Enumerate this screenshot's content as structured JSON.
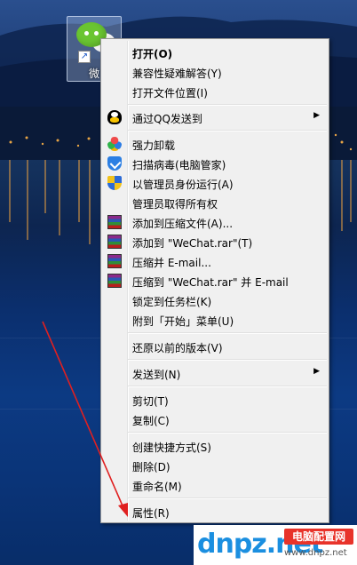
{
  "desktop": {
    "icon": {
      "name": "wechat-icon",
      "label": "微"
    }
  },
  "context_menu": {
    "items": [
      {
        "label": "打开(O)",
        "bold": true
      },
      {
        "label": "兼容性疑难解答(Y)"
      },
      {
        "label": "打开文件位置(I)"
      },
      {
        "label": "通过QQ发送到",
        "submenu": true,
        "icon": "qq-icon"
      },
      {
        "label": "强力卸载",
        "icon": "uninstall-icon"
      },
      {
        "label": "扫描病毒(电脑管家)",
        "icon": "pc-manager-shield-icon"
      },
      {
        "label": "以管理员身份运行(A)",
        "icon": "uac-shield-icon"
      },
      {
        "label": "管理员取得所有权"
      },
      {
        "label": "添加到压缩文件(A)...",
        "icon": "winrar-icon"
      },
      {
        "label": "添加到 \"WeChat.rar\"(T)",
        "icon": "winrar-icon"
      },
      {
        "label": "压缩并 E-mail...",
        "icon": "winrar-icon"
      },
      {
        "label": "压缩到 \"WeChat.rar\" 并 E-mail",
        "icon": "winrar-icon"
      },
      {
        "label": "锁定到任务栏(K)"
      },
      {
        "label": "附到「开始」菜单(U)"
      },
      {
        "label": "还原以前的版本(V)"
      },
      {
        "label": "发送到(N)",
        "submenu": true
      },
      {
        "label": "剪切(T)"
      },
      {
        "label": "复制(C)"
      },
      {
        "label": "创建快捷方式(S)"
      },
      {
        "label": "删除(D)"
      },
      {
        "label": "重命名(M)"
      },
      {
        "label": "属性(R)"
      }
    ],
    "submenu_arrow": "▶"
  },
  "watermark": {
    "logo": "dnpz.net",
    "badge": "电脑配置网",
    "url": "www.dnpz.net"
  }
}
